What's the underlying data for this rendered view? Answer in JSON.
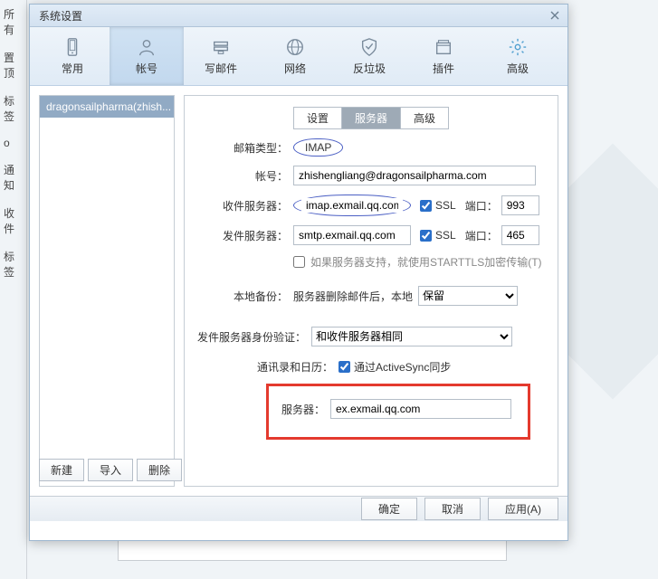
{
  "bg_nav": [
    "所有",
    "置顶",
    "标签",
    "o",
    "通知",
    "收件",
    "标签"
  ],
  "dialog": {
    "title": "系统设置",
    "toolbar": [
      {
        "key": "common",
        "label": "常用"
      },
      {
        "key": "account",
        "label": "帐号"
      },
      {
        "key": "compose",
        "label": "写邮件"
      },
      {
        "key": "network",
        "label": "网络"
      },
      {
        "key": "antispam",
        "label": "反垃圾"
      },
      {
        "key": "plugins",
        "label": "插件"
      },
      {
        "key": "advanced",
        "label": "高级"
      }
    ],
    "left_items": [
      "dragonsailpharma(zhish..."
    ],
    "subtabs": [
      {
        "label": "设置"
      },
      {
        "label": "服务器"
      },
      {
        "label": "高级"
      }
    ],
    "form": {
      "labels": {
        "mailbox_type": "邮箱类型：",
        "account": "帐号：",
        "incoming": "收件服务器：",
        "outgoing": "发件服务器：",
        "ssl": "SSL",
        "port": "端口：",
        "starttls": "如果服务器支持，就使用STARTTLS加密传输(T)",
        "local_backup": "本地备份：",
        "local_backup_text": "服务器删除邮件后，本地",
        "outgoing_auth": "发件服务器身份验证：",
        "addr_cal": "通讯录和日历：",
        "activesync": "通过ActiveSync同步",
        "server": "服务器："
      },
      "values": {
        "mailbox_type": "IMAP",
        "account": "zhishengliang@dragonsailpharma.com",
        "incoming_server": "imap.exmail.qq.com",
        "incoming_ssl": true,
        "incoming_port": "993",
        "outgoing_server": "smtp.exmail.qq.com",
        "outgoing_ssl": true,
        "outgoing_port": "465",
        "starttls_enabled": false,
        "local_backup_option": "保留",
        "outgoing_auth_option": "和收件服务器相同",
        "activesync_enabled": true,
        "sync_server": "ex.exmail.qq.com"
      }
    },
    "buttons": {
      "new": "新建",
      "import": "导入",
      "delete": "删除",
      "ok": "确定",
      "cancel": "取消",
      "apply": "应用(A)"
    }
  },
  "icons": {
    "common": "phone",
    "account": "person",
    "compose": "stack",
    "network": "globe",
    "antispam": "shield",
    "plugins": "box",
    "advanced": "gear",
    "close": "x"
  },
  "colors": {
    "accent": "#2a6fc9",
    "highlight_ring": "#4b5fc4",
    "red_box": "#e43a2e"
  }
}
